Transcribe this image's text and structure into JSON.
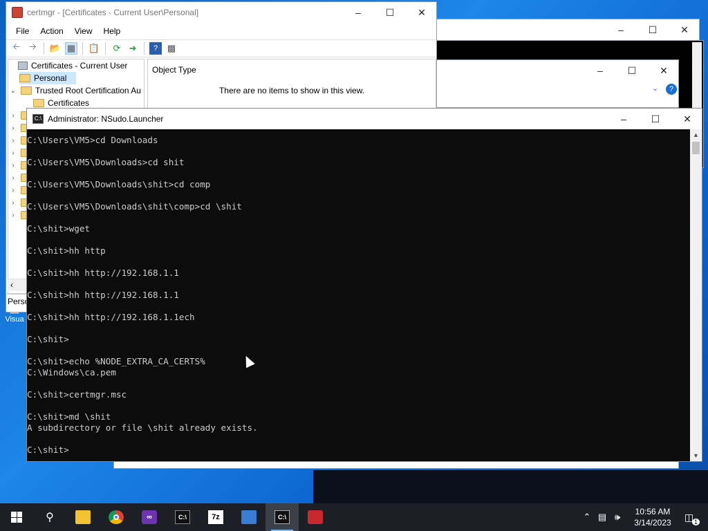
{
  "certmgr": {
    "title": "certmgr - [Certificates - Current User\\Personal]",
    "menu": [
      "File",
      "Action",
      "View",
      "Help"
    ],
    "tree": {
      "root": "Certificates - Current User",
      "personal": "Personal",
      "trusted_root": "Trusted Root Certification Au",
      "certificates": "Certificates"
    },
    "column_header": "Object Type",
    "empty_message": "There are no items to show in this view.",
    "status": "Perso"
  },
  "console": {
    "title": "Administrator: NSudo.Launcher",
    "lines": [
      "C:\\Users\\VM5>cd Downloads",
      "",
      "C:\\Users\\VM5\\Downloads>cd shit",
      "",
      "C:\\Users\\VM5\\Downloads\\shit>cd comp",
      "",
      "C:\\Users\\VM5\\Downloads\\shit\\comp>cd \\shit",
      "",
      "C:\\shit>wget",
      "",
      "C:\\shit>hh http",
      "",
      "C:\\shit>hh http://192.168.1.1",
      "",
      "C:\\shit>hh http://192.168.1.1",
      "",
      "C:\\shit>hh http://192.168.1.1ech",
      "",
      "C:\\shit>",
      "",
      "C:\\shit>echo %NODE_EXTRA_CA_CERTS%",
      "C:\\Windows\\ca.pem",
      "",
      "C:\\shit>certmgr.msc",
      "",
      "C:\\shit>md \\shit",
      "A subdirectory or file \\shit already exists.",
      "",
      "C:\\shit>"
    ]
  },
  "desktop_icon_label": "Visua",
  "taskbar": {
    "time": "10:56 AM",
    "date": "3/14/2023",
    "notification_count": "1",
    "apps": [
      "file-explorer-icon",
      "chrome-icon",
      "visual-studio-icon",
      "terminal-icon",
      "7zip-icon",
      "mmc-icon",
      "console-icon",
      "toolbox-icon"
    ]
  }
}
